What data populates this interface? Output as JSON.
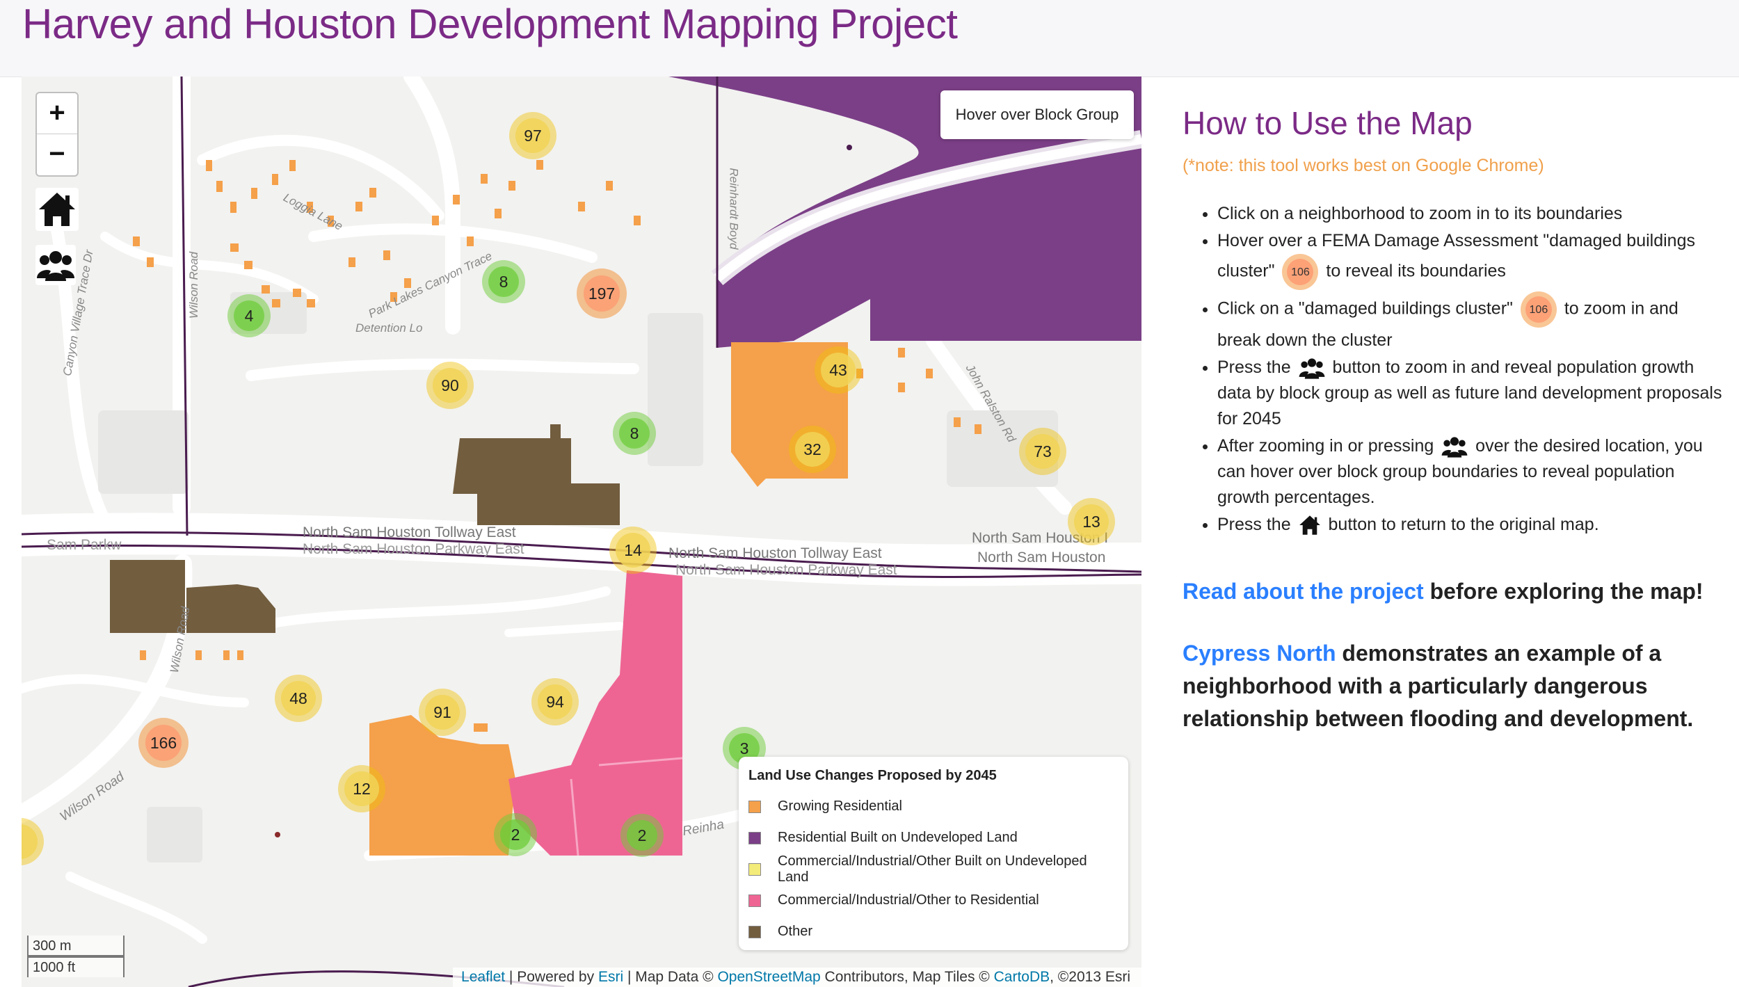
{
  "header": {
    "title": "Harvey and Houston Development Mapping Project"
  },
  "map": {
    "zoom_in_label": "+",
    "zoom_out_label": "−",
    "home_icon": "home-icon",
    "population_icon": "users-icon",
    "info_control": "Hover over Block Group",
    "clusters": [
      "97",
      "8",
      "197",
      "4",
      "90",
      "8",
      "43",
      "32",
      "73",
      "13",
      "14",
      "48",
      "91",
      "94",
      "166",
      "3",
      "12",
      "2",
      "2"
    ],
    "street_labels": {
      "loggia_lane": "Loggia Lane",
      "park_lakes": "Park Lakes Canyon Trace",
      "detention": "Detention Lo",
      "canyon_village": "Canyon Village Trace Dr",
      "wilson_road": "Wilson Road",
      "wilson_road_s": "Wilson Road",
      "wilson_road_sw": "Wilson Road",
      "reinhardt": "Reinhardt Boyd",
      "john_ralston": "John Ralston Rd",
      "tollway_1": "North Sam Houston Tollway East",
      "tollway_2": "North Sam Houston Parkway East",
      "tollway_3": "North Sam Houston Tollway East",
      "tollway_4": "North Sam Houston Parkway East",
      "tollway_5": "North Sam Houston I",
      "tollway_6": "North Sam Houston",
      "reinhar": "Reinha",
      "sam_parkw": "Sam Parkw"
    },
    "legend": {
      "title": "Land Use Changes Proposed by 2045",
      "items": [
        {
          "label": "Growing Residential",
          "color": "#f5a04a"
        },
        {
          "label": "Residential Built on Undeveloped Land",
          "color": "#7b3f87"
        },
        {
          "label": "Commercial/Industrial/Other Built on Undeveloped Land",
          "color": "#f4ec7a"
        },
        {
          "label": "Commercial/Industrial/Other to Residential",
          "color": "#ee6593"
        },
        {
          "label": "Other",
          "color": "#725d3f"
        }
      ]
    },
    "scale": {
      "metric": "300 m",
      "imperial": "1000 ft"
    },
    "attribution": {
      "leaflet": "Leaflet",
      "sep1": " | Powered by ",
      "esri": "Esri",
      "sep2": " | Map Data © ",
      "osm": "OpenStreetMap",
      "sep3": " Contributors, Map Tiles © ",
      "carto": "CartoDB",
      "sep4": ", ©2013 Esri"
    }
  },
  "sidebar": {
    "title": "How to Use the Map",
    "note": "(*note: this tool works best on Google Chrome)",
    "instructions": {
      "i1": "Click on a neighborhood to zoom in to its boundaries",
      "i2a": "Hover over a FEMA Damage Assessment \"damaged buildings cluster\"",
      "i2b": "to reveal its boundaries",
      "i3a": "Click on a \"damaged buildings cluster\"",
      "i3b": "to zoom in and break down the cluster",
      "i4a": "Press the",
      "i4b": "button to zoom in and reveal population growth data by block group as well as future land development proposals for 2045",
      "i5a": "After zooming in or pressing",
      "i5b": "over the desired location, you can hover over block group boundaries to reveal population growth percentages.",
      "i6a": "Press the",
      "i6b": "button to return to the original map.",
      "cluster_example": "106"
    },
    "read_about_link": "Read about the project",
    "read_about_rest": " before exploring the map!",
    "cypress_link": "Cypress North",
    "cypress_rest": " demonstrates an example of a neighborhood with a particularly dangerous relationship between flooding and development."
  }
}
